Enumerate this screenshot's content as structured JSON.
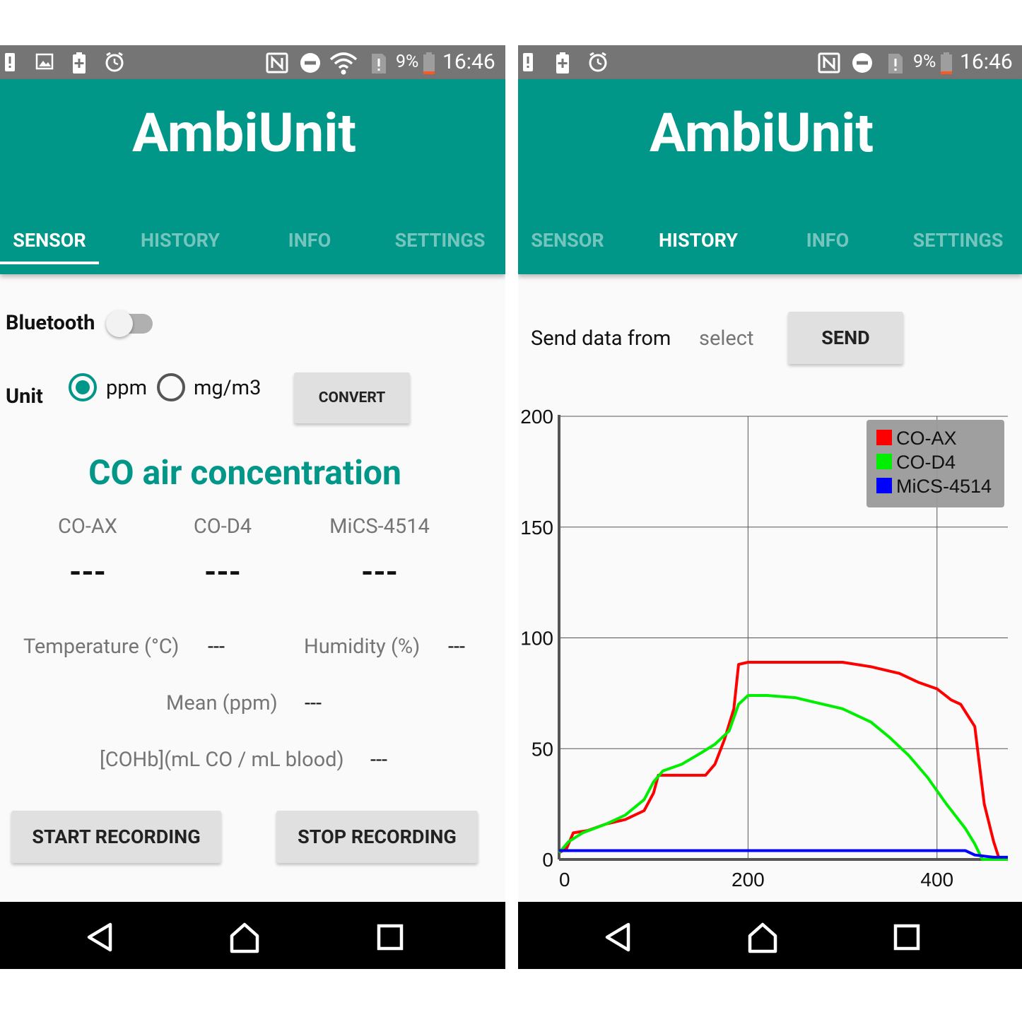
{
  "status_bar": {
    "battery_percent": "9%",
    "time": "16:46"
  },
  "app": {
    "title": "AmbiUnit"
  },
  "tabs": [
    "SENSOR",
    "HISTORY",
    "INFO",
    "SETTINGS"
  ],
  "sensor_screen": {
    "active_tab": "SENSOR",
    "bluetooth_label": "Bluetooth",
    "bluetooth_on": false,
    "unit_label": "Unit",
    "unit_options": [
      "ppm",
      "mg/m3"
    ],
    "unit_selected": "ppm",
    "convert_button": "CONVERT",
    "heading": "CO air concentration",
    "sensors": [
      {
        "name": "CO-AX",
        "value": "---"
      },
      {
        "name": "CO-D4",
        "value": "---"
      },
      {
        "name": "MiCS-4514",
        "value": "---"
      }
    ],
    "temperature_label": "Temperature (°C)",
    "temperature_value": "---",
    "humidity_label": "Humidity (%)",
    "humidity_value": "---",
    "mean_label": "Mean (ppm)",
    "mean_value": "---",
    "cohb_label": "[COHb](mL CO / mL blood)",
    "cohb_value": "---",
    "start_button": "START RECORDING",
    "stop_button": "STOP RECORDING"
  },
  "history_screen": {
    "active_tab": "HISTORY",
    "send_label": "Send data from",
    "select_placeholder": "select",
    "send_button": "SEND"
  },
  "colors": {
    "primary": "#009688",
    "status_bar": "#757575",
    "co_ax": "#ff0000",
    "co_d4": "#00ee00",
    "mics": "#0000ff"
  },
  "chart_data": {
    "type": "line",
    "title": "",
    "xlabel": "",
    "ylabel": "",
    "xlim": [
      0,
      475
    ],
    "ylim": [
      0,
      200
    ],
    "x_ticks": [
      0,
      200,
      400
    ],
    "y_ticks": [
      0,
      50,
      100,
      150,
      200
    ],
    "grid": true,
    "legend_position": "top-right",
    "series": [
      {
        "name": "CO-AX",
        "color": "#ff0000",
        "points": [
          [
            0,
            3
          ],
          [
            8,
            5
          ],
          [
            15,
            12
          ],
          [
            30,
            13
          ],
          [
            50,
            16
          ],
          [
            70,
            18
          ],
          [
            90,
            22
          ],
          [
            100,
            30
          ],
          [
            105,
            38
          ],
          [
            120,
            38
          ],
          [
            140,
            38
          ],
          [
            155,
            38
          ],
          [
            165,
            43
          ],
          [
            175,
            54
          ],
          [
            185,
            68
          ],
          [
            190,
            88
          ],
          [
            200,
            89
          ],
          [
            220,
            89
          ],
          [
            250,
            89
          ],
          [
            280,
            89
          ],
          [
            300,
            89
          ],
          [
            330,
            87
          ],
          [
            360,
            84
          ],
          [
            380,
            80
          ],
          [
            400,
            77
          ],
          [
            415,
            72
          ],
          [
            425,
            70
          ],
          [
            440,
            60
          ],
          [
            450,
            25
          ],
          [
            460,
            8
          ],
          [
            466,
            0
          ]
        ]
      },
      {
        "name": "CO-D4",
        "color": "#00ee00",
        "points": [
          [
            0,
            3
          ],
          [
            10,
            8
          ],
          [
            25,
            12
          ],
          [
            50,
            16
          ],
          [
            70,
            20
          ],
          [
            90,
            27
          ],
          [
            100,
            35
          ],
          [
            110,
            40
          ],
          [
            130,
            43
          ],
          [
            150,
            48
          ],
          [
            165,
            52
          ],
          [
            180,
            58
          ],
          [
            190,
            70
          ],
          [
            200,
            74
          ],
          [
            220,
            74
          ],
          [
            250,
            73
          ],
          [
            270,
            71
          ],
          [
            300,
            68
          ],
          [
            330,
            62
          ],
          [
            350,
            55
          ],
          [
            370,
            47
          ],
          [
            390,
            37
          ],
          [
            410,
            25
          ],
          [
            430,
            14
          ],
          [
            440,
            7
          ],
          [
            448,
            0
          ],
          [
            475,
            0
          ]
        ]
      },
      {
        "name": "MiCS-4514",
        "color": "#0000ff",
        "points": [
          [
            0,
            4
          ],
          [
            100,
            4
          ],
          [
            200,
            4
          ],
          [
            300,
            4
          ],
          [
            400,
            4
          ],
          [
            430,
            4
          ],
          [
            440,
            2
          ],
          [
            460,
            1
          ],
          [
            475,
            1
          ]
        ]
      }
    ]
  }
}
